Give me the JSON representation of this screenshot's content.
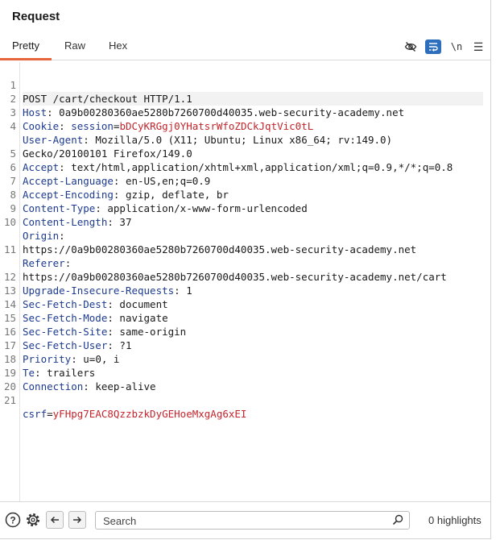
{
  "panel": {
    "title": "Request"
  },
  "tabs": [
    {
      "label": "Pretty"
    },
    {
      "label": "Raw"
    },
    {
      "label": "Hex"
    }
  ],
  "toolbar": {
    "newline_label": "\\n"
  },
  "icons": {
    "eye": "eye-slash-icon",
    "wrap": "word-wrap-icon",
    "menu": "hamburger-menu-icon",
    "help": "help-icon",
    "settings": "gear-icon",
    "back": "arrow-left-icon",
    "forward": "arrow-right-icon",
    "search": "magnifier-icon"
  },
  "colors": {
    "accent": "#e8643b",
    "header_key": "#1d3b8f",
    "param_value": "#c4252c",
    "wrap_active": "#2e6fbd"
  },
  "request": {
    "lines": [
      {
        "n": "1",
        "key": "",
        "text": "POST /cart/checkout HTTP/1.1"
      },
      {
        "n": "2",
        "key": "Host",
        "text": " 0a9b00280360ae5280b7260700d40035.web-security-academy.net"
      },
      {
        "n": "3",
        "key": "Cookie",
        "text": " ",
        "ckey": "session",
        "cval": "bDCyKRGgj0YHatsrWfoZDCkJqtVic0tL"
      },
      {
        "n": "4",
        "key": "User-Agent",
        "text": " Mozilla/5.0 (X11; Ubuntu; Linux x86_64; rv:149.0)"
      },
      {
        "n": "",
        "key": "",
        "text": "Gecko/20100101 Firefox/149.0"
      },
      {
        "n": "5",
        "key": "Accept",
        "text": " text/html,application/xhtml+xml,application/xml;q=0.9,*/*;q=0.8"
      },
      {
        "n": "6",
        "key": "Accept-Language",
        "text": " en-US,en;q=0.9"
      },
      {
        "n": "7",
        "key": "Accept-Encoding",
        "text": " gzip, deflate, br"
      },
      {
        "n": "8",
        "key": "Content-Type",
        "text": " application/x-www-form-urlencoded"
      },
      {
        "n": "9",
        "key": "Content-Length",
        "text": " 37"
      },
      {
        "n": "10",
        "key": "Origin",
        "text": ""
      },
      {
        "n": "",
        "key": "",
        "text": "https://0a9b00280360ae5280b7260700d40035.web-security-academy.net"
      },
      {
        "n": "11",
        "key": "Referer",
        "text": ""
      },
      {
        "n": "",
        "key": "",
        "text": "https://0a9b00280360ae5280b7260700d40035.web-security-academy.net/cart"
      },
      {
        "n": "12",
        "key": "Upgrade-Insecure-Requests",
        "text": " 1"
      },
      {
        "n": "13",
        "key": "Sec-Fetch-Dest",
        "text": " document"
      },
      {
        "n": "14",
        "key": "Sec-Fetch-Mode",
        "text": " navigate"
      },
      {
        "n": "15",
        "key": "Sec-Fetch-Site",
        "text": " same-origin"
      },
      {
        "n": "16",
        "key": "Sec-Fetch-User",
        "text": " ?1"
      },
      {
        "n": "17",
        "key": "Priority",
        "text": " u=0, i"
      },
      {
        "n": "18",
        "key": "Te",
        "text": " trailers"
      },
      {
        "n": "19",
        "key": "Connection",
        "text": " keep-alive"
      },
      {
        "n": "20",
        "key": "",
        "text": ""
      },
      {
        "n": "21",
        "key": "",
        "text": "",
        "pkey": "csrf",
        "pval": "yFHpg7EAC8QzzbzkDyGEHoeMxgAg6xEI"
      }
    ]
  },
  "search": {
    "placeholder": "Search",
    "highlights": "0 highlights"
  }
}
